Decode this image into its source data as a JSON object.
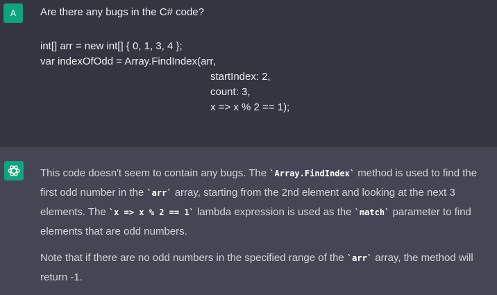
{
  "user_message": {
    "avatar_letter": "A",
    "avatar_color": "#10a37f",
    "question": "Are there any bugs in the C# code?",
    "code_lines": [
      "int[] arr = new int[] { 0, 1, 3, 4 };",
      "var indexOfOdd = Array.FindIndex(arr,",
      "startIndex: 2,",
      "count: 3,",
      "x => x % 2 == 1);"
    ]
  },
  "assistant_message": {
    "avatar_icon": "openai-logo-icon",
    "avatar_color": "#10a37f",
    "paragraph1": {
      "t1": "This code doesn't seem to contain any bugs. The ",
      "c1": "`Array.FindIndex`",
      "t2": " method is used to find the first odd number in the ",
      "c2": "`arr`",
      "t3": " array, starting from the 2nd element and looking at the next 3 elements. The ",
      "c3": "`x => x % 2 == 1`",
      "t4": " lambda expression is used as the ",
      "c4": "`match`",
      "t5": " parameter to find elements that are odd numbers."
    },
    "paragraph2": {
      "t1": "Note that if there are no odd numbers in the specified range of the ",
      "c1": "`arr`",
      "t2": " array, the method will return -1."
    }
  }
}
